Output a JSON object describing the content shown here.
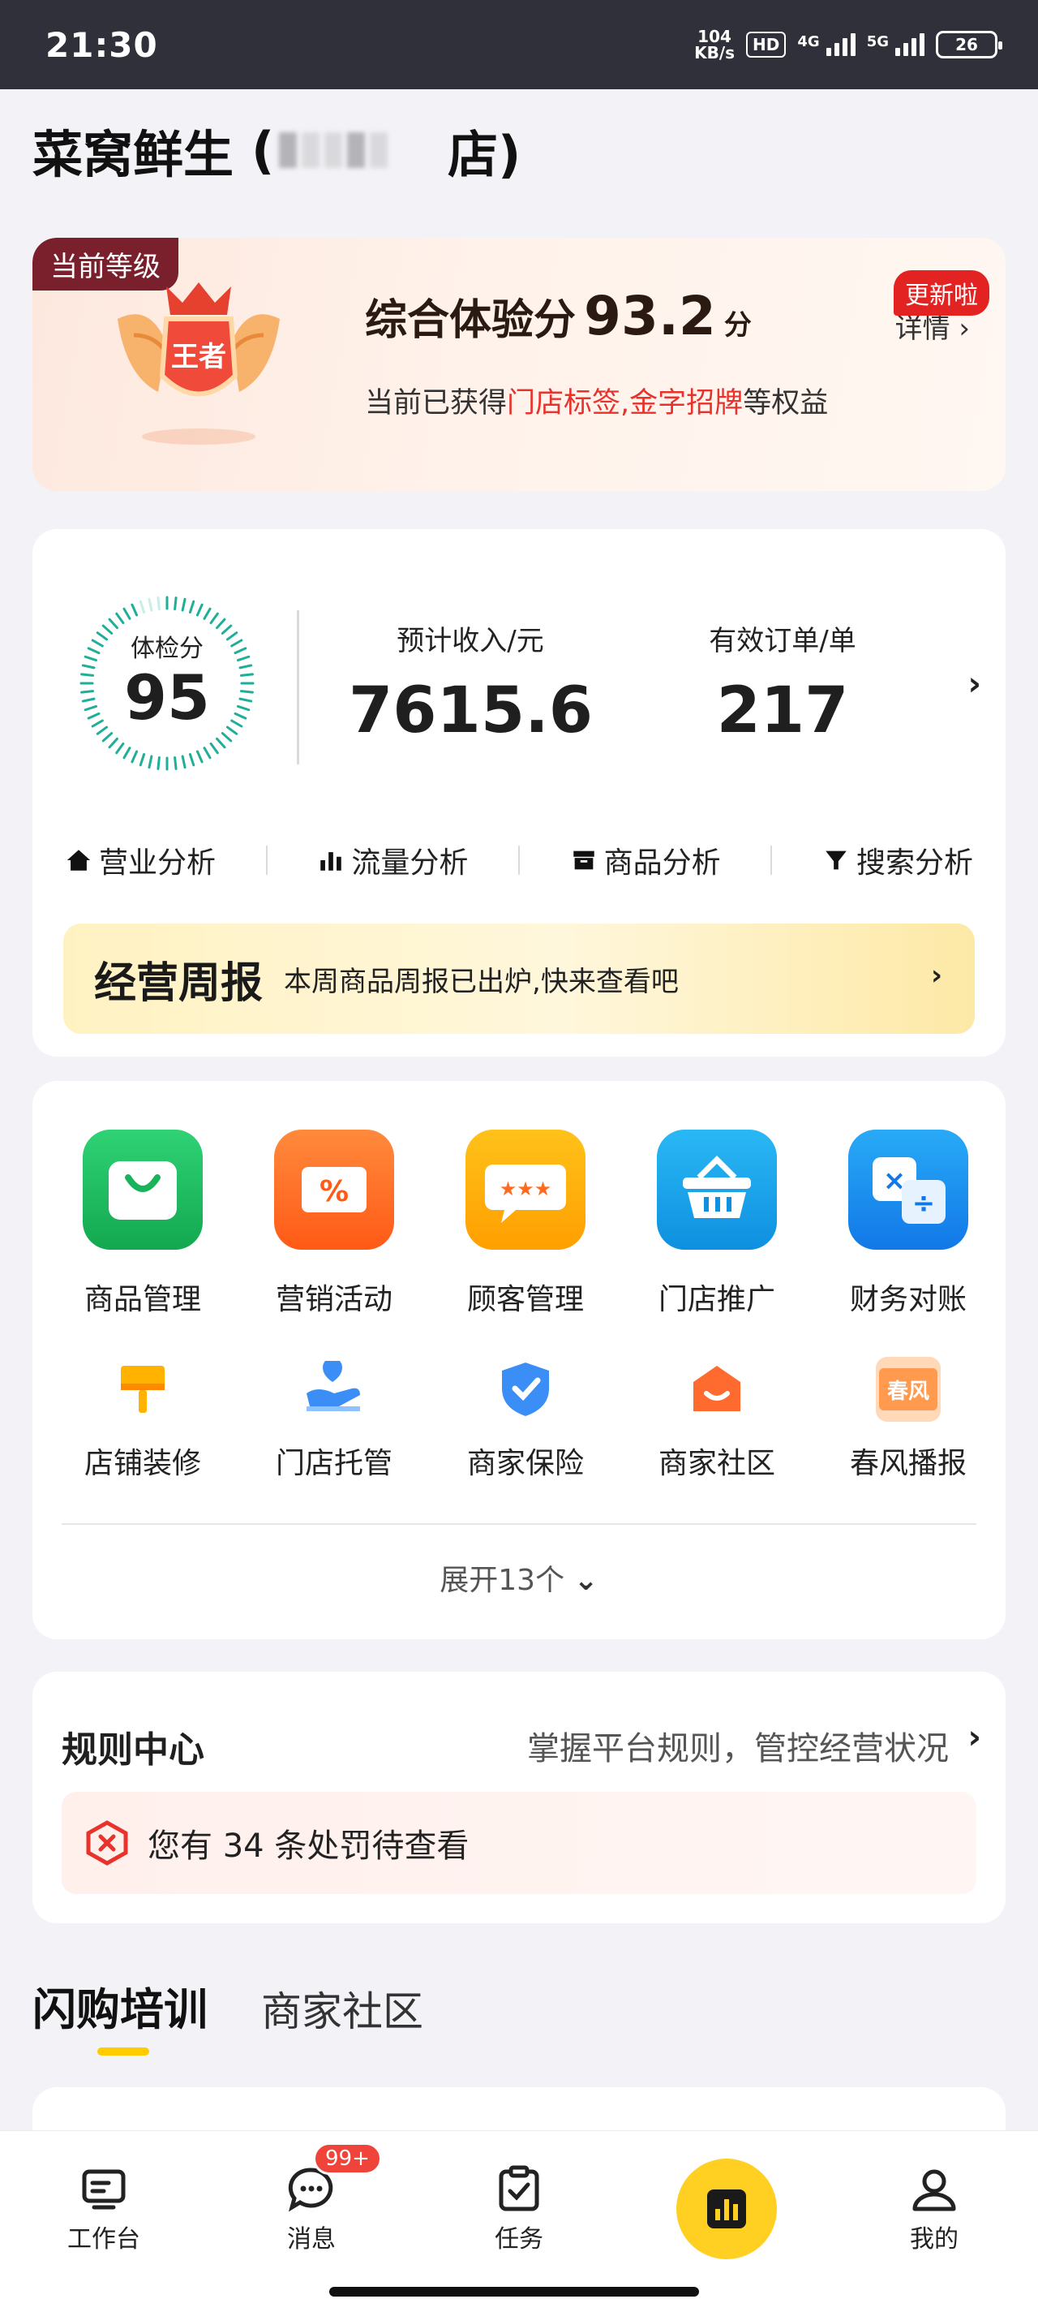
{
  "status_bar": {
    "time": "21:30",
    "speed_value": "104",
    "speed_unit": "KB/s",
    "hd": "HD",
    "net1": "4G",
    "net2": "5G",
    "battery": "26"
  },
  "store": {
    "name": "菜窝鲜生",
    "name_suffix": "店)"
  },
  "level_card": {
    "tag": "当前等级",
    "badge_text": "王者",
    "score_label": "综合体验分",
    "score_value": "93.2",
    "score_unit": "分",
    "desc_prefix": "当前已获得",
    "desc_highlight1": "门店标签",
    "desc_comma": ",",
    "desc_highlight2": "金字招牌",
    "desc_suffix": "等权益",
    "detail_link": "详情 ›",
    "new_badge": "更新啦"
  },
  "stats": {
    "gauge_label": "体检分",
    "gauge_value": "95",
    "gauge_fraction": 0.95,
    "revenue_label": "预计收入/元",
    "revenue_value": "7615.6",
    "orders_label": "有效订单/单",
    "orders_value": "217",
    "analysis": [
      {
        "label": "营业分析",
        "icon": "home-icon"
      },
      {
        "label": "流量分析",
        "icon": "bar-chart-icon"
      },
      {
        "label": "商品分析",
        "icon": "box-icon"
      },
      {
        "label": "搜索分析",
        "icon": "filter-icon"
      }
    ],
    "weekly_title": "经营周报",
    "weekly_desc": "本周商品周报已出炉,快来查看吧"
  },
  "tools": {
    "row1": [
      {
        "label": "商品管理",
        "icon": "shopping-bag-icon",
        "color": "#1fc163"
      },
      {
        "label": "营销活动",
        "icon": "coupon-icon",
        "color": "#ff6a1f"
      },
      {
        "label": "顾客管理",
        "icon": "chat-star-icon",
        "color": "#ffb300"
      },
      {
        "label": "门店推广",
        "icon": "basket-icon",
        "color": "#19a6ee"
      },
      {
        "label": "财务对账",
        "icon": "calculator-icon",
        "color": "#1a8cf2"
      }
    ],
    "row2": [
      {
        "label": "店铺装修",
        "icon": "paint-brush-icon",
        "color": "#ffb300"
      },
      {
        "label": "门店托管",
        "icon": "hand-shake-icon",
        "color": "#3b8ef5"
      },
      {
        "label": "商家保险",
        "icon": "shield-check-icon",
        "color": "#3b8ef5"
      },
      {
        "label": "商家社区",
        "icon": "house-chat-icon",
        "color": "#ff6a2f"
      },
      {
        "label": "春风播报",
        "icon": "spring-news-icon",
        "color": "#ff9a4f",
        "icon_text": "春风"
      }
    ],
    "expand_label": "展开13个"
  },
  "rules": {
    "title": "规则中心",
    "subtitle": "掌握平台规则，管控经营状况",
    "penalty_text": "您有 34 条处罚待查看"
  },
  "tabs": {
    "active": "闪购培训",
    "other": "商家社区"
  },
  "bottom_nav": {
    "workbench": "工作台",
    "messages": "消息",
    "messages_badge": "99+",
    "tasks": "任务",
    "mine": "我的"
  }
}
